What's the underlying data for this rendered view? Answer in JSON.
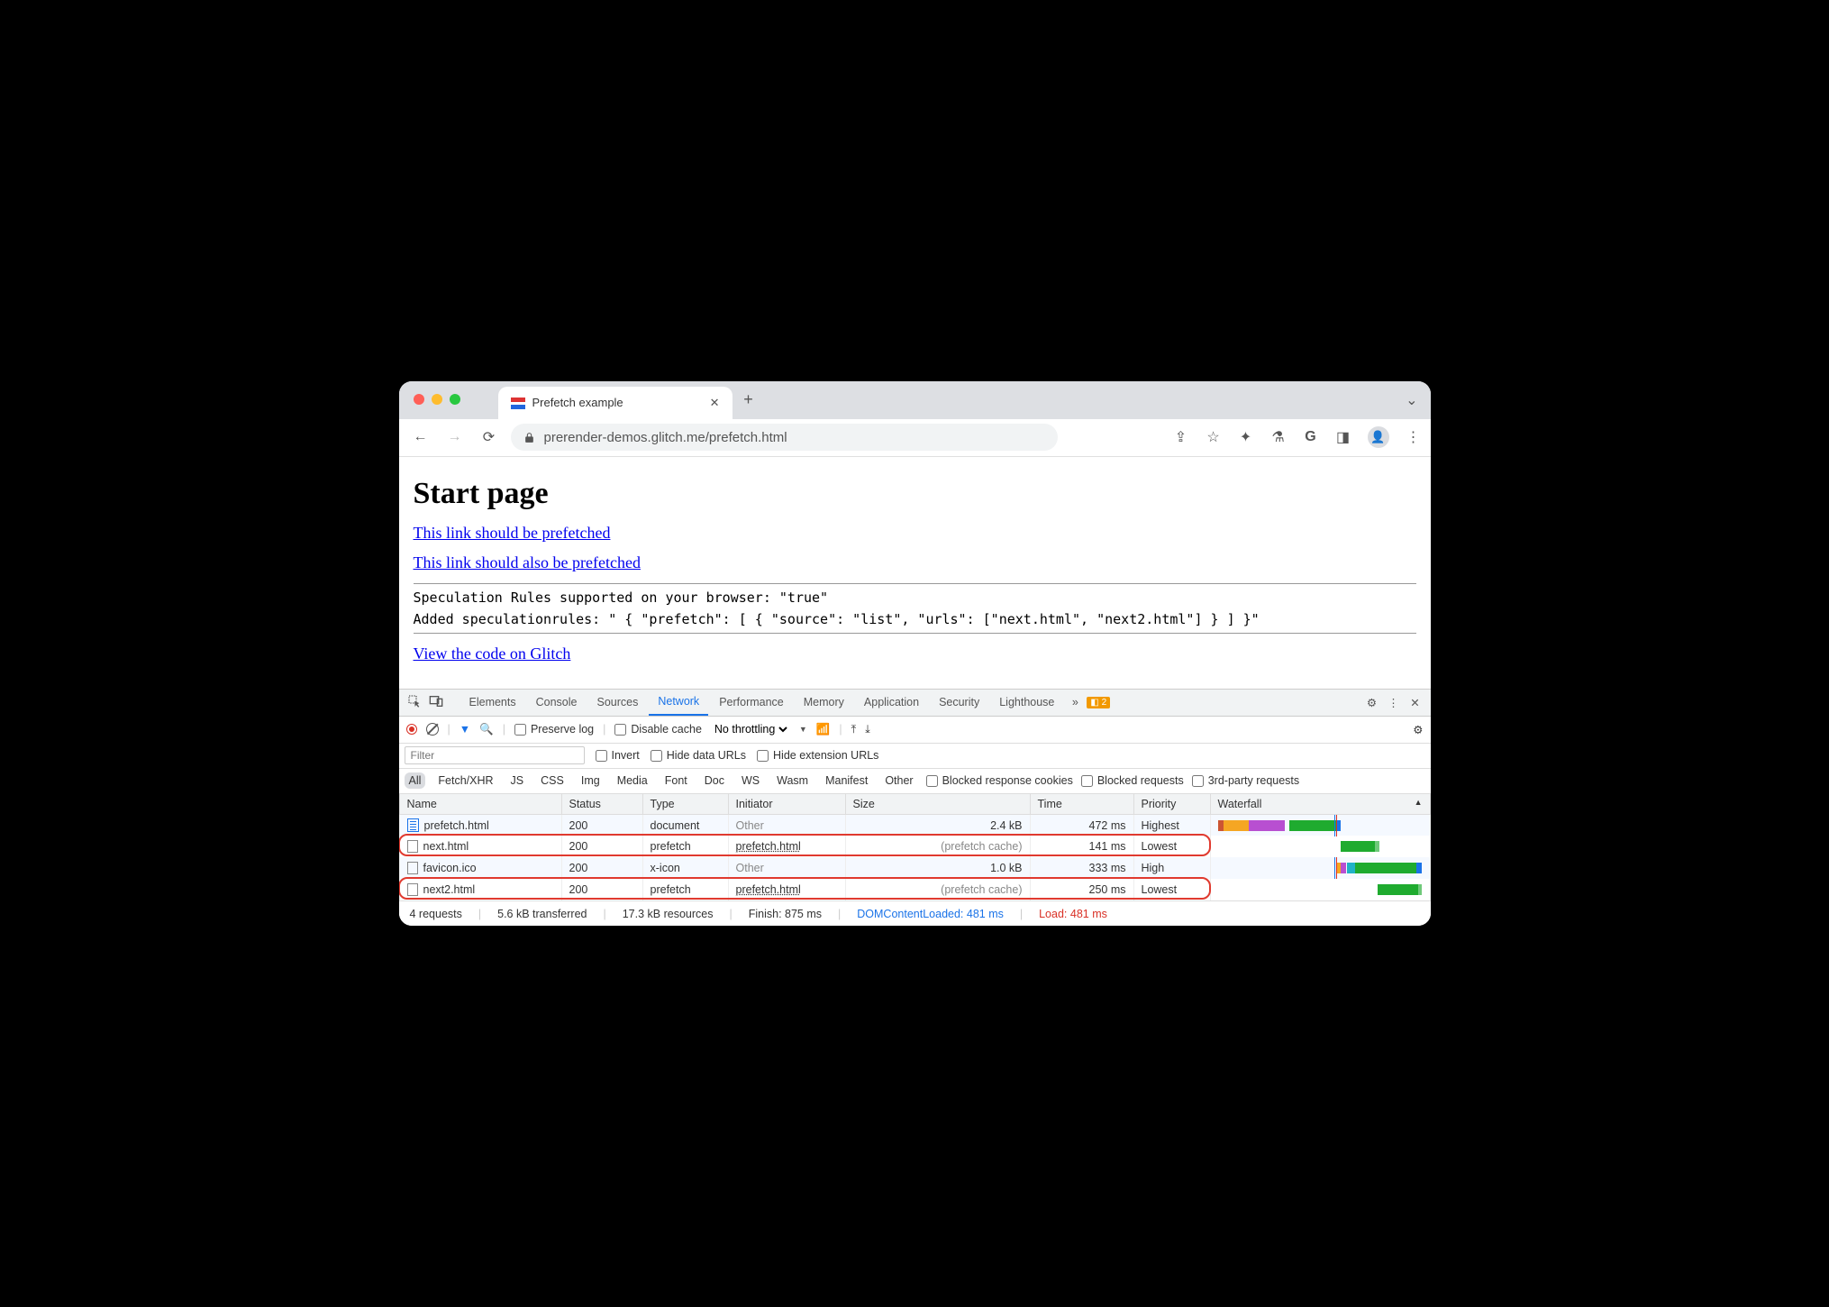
{
  "browser": {
    "tab_title": "Prefetch example",
    "url": "prerender-demos.glitch.me/prefetch.html"
  },
  "page": {
    "heading": "Start page",
    "link1": "This link should be prefetched",
    "link2": "This link should also be prefetched",
    "mono1": "Speculation Rules supported on your browser: \"true\"",
    "mono2": "Added speculationrules: \" { \"prefetch\": [ { \"source\": \"list\", \"urls\": [\"next.html\", \"next2.html\"] } ] }\"",
    "link3": "View the code on Glitch"
  },
  "devtools": {
    "tabs": {
      "elements": "Elements",
      "console": "Console",
      "sources": "Sources",
      "network": "Network",
      "performance": "Performance",
      "memory": "Memory",
      "application": "Application",
      "security": "Security",
      "lighthouse": "Lighthouse"
    },
    "warn_count": "2",
    "toolbar": {
      "preserve": "Preserve log",
      "disable_cache": "Disable cache",
      "throttling": "No throttling"
    },
    "filter": {
      "placeholder": "Filter",
      "invert": "Invert",
      "hide_data": "Hide data URLs",
      "hide_ext": "Hide extension URLs"
    },
    "types": {
      "all": "All",
      "fetch": "Fetch/XHR",
      "js": "JS",
      "css": "CSS",
      "img": "Img",
      "media": "Media",
      "font": "Font",
      "doc": "Doc",
      "ws": "WS",
      "wasm": "Wasm",
      "manifest": "Manifest",
      "other": "Other",
      "blocked_cookies": "Blocked response cookies",
      "blocked_req": "Blocked requests",
      "third_party": "3rd-party requests"
    },
    "columns": {
      "name": "Name",
      "status": "Status",
      "type": "Type",
      "initiator": "Initiator",
      "size": "Size",
      "time": "Time",
      "priority": "Priority",
      "waterfall": "Waterfall"
    },
    "rows": [
      {
        "name": "prefetch.html",
        "status": "200",
        "type": "document",
        "initiator": "Other",
        "initiator_dim": true,
        "size": "2.4 kB",
        "time": "472 ms",
        "priority": "Highest"
      },
      {
        "name": "next.html",
        "status": "200",
        "type": "prefetch",
        "initiator": "prefetch.html",
        "initiator_dim": false,
        "size": "(prefetch cache)",
        "time": "141 ms",
        "priority": "Lowest",
        "highlight": true
      },
      {
        "name": "favicon.ico",
        "status": "200",
        "type": "x-icon",
        "initiator": "Other",
        "initiator_dim": true,
        "size": "1.0 kB",
        "time": "333 ms",
        "priority": "High"
      },
      {
        "name": "next2.html",
        "status": "200",
        "type": "prefetch",
        "initiator": "prefetch.html",
        "initiator_dim": false,
        "size": "(prefetch cache)",
        "time": "250 ms",
        "priority": "Lowest",
        "highlight": true
      }
    ],
    "summary": {
      "requests": "4 requests",
      "transferred": "5.6 kB transferred",
      "resources": "17.3 kB resources",
      "finish": "Finish: 875 ms",
      "dcl": "DOMContentLoaded: 481 ms",
      "load": "Load: 481 ms"
    }
  }
}
